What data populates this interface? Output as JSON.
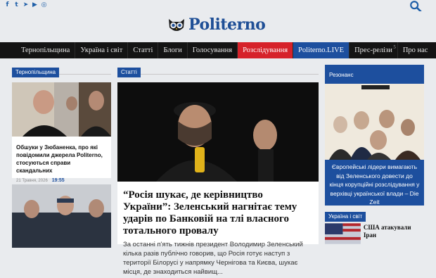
{
  "social": {
    "icons": [
      "facebook-icon",
      "twitter-icon",
      "telegram-icon",
      "youtube-icon",
      "instagram-icon"
    ],
    "glyphs": [
      "f",
      "t",
      "➤",
      "▶",
      "◎"
    ]
  },
  "brand": {
    "name": "Politerno",
    "color": "#1f4f96"
  },
  "nav": {
    "items": [
      {
        "label": "Тернопільщина",
        "style": ""
      },
      {
        "label": "Україна і світ",
        "style": ""
      },
      {
        "label": "Статті",
        "style": ""
      },
      {
        "label": "Блоги",
        "style": ""
      },
      {
        "label": "Голосування",
        "style": ""
      },
      {
        "label": "Розслідування",
        "style": "red"
      },
      {
        "label": "Politerno.LIVE",
        "style": "blue"
      },
      {
        "label": "Прес-релізи",
        "style": "",
        "badge": "5"
      },
      {
        "label": "Про нас",
        "style": "plain"
      }
    ]
  },
  "left": {
    "tag": "Тернопільщина",
    "card1": {
      "title": "Обшуки у Зюбаненка, про які повідомили джерела Politerno, стосуються справи скандальних",
      "date": "21 Травня, 2026",
      "time": "19:55"
    }
  },
  "middle": {
    "tag": "Статті",
    "title": "“Росія шукає, де керівництво України”: Зеленський нагнітає тему ударів по Банковій на тлі власного тотального провалу",
    "lead": "За останні п'ять тижнів президент Володимир Зеленський кілька разів публічно говорив, що Росія готує наступ з території Білорусі у напрямку Чернігова та Києва, шукає місця, де знаходиться найвищ..."
  },
  "right": {
    "tag": "Резонанс",
    "promo_text": "Європейські лідери вимагають від Зеленського довести до кінця корупційні розслідування у верхівці української влади – Die Zeit",
    "tag2": "Україна і світ",
    "card_title": "США атакували Іран"
  }
}
